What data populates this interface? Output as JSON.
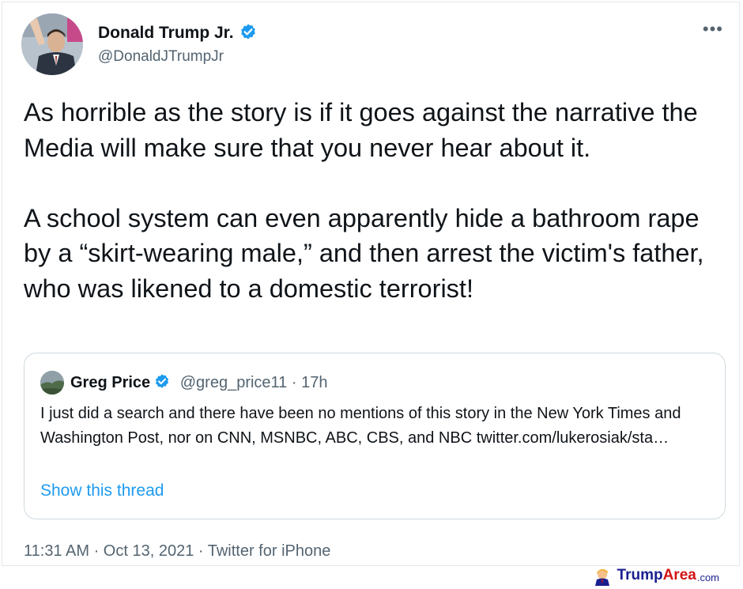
{
  "author": {
    "name": "Donald Trump Jr.",
    "handle": "@DonaldJTrumpJr"
  },
  "menu_icon": "more-horizontal-icon",
  "tweet": {
    "paragraphs": [
      "As horrible as the story is if it goes against the narrative the Media will make sure that you never hear about it.",
      "A school system can even apparently hide a bathroom rape by a “skirt-wearing male,” and then arrest the victim's father, who was likened to a domestic terrorist!"
    ]
  },
  "quote": {
    "name": "Greg Price",
    "handle": "@greg_price11",
    "separator": "·",
    "time": "17h",
    "body": "I just did a search and there have been no mentions of this story in the New York Times and Washington Post, nor on CNN, MSNBC, ABC, CBS, and NBC twitter.com/lukerosiak/sta…",
    "show_thread": "Show this thread"
  },
  "meta": {
    "text": "11:31 AM · Oct 13, 2021 · Twitter for iPhone"
  },
  "watermark": {
    "part1": "Trump",
    "part2": "Area",
    "part3": ".com"
  },
  "colors": {
    "verified": "#1d9bf0",
    "link": "#1d9bf0",
    "secondary_text": "#536471"
  }
}
